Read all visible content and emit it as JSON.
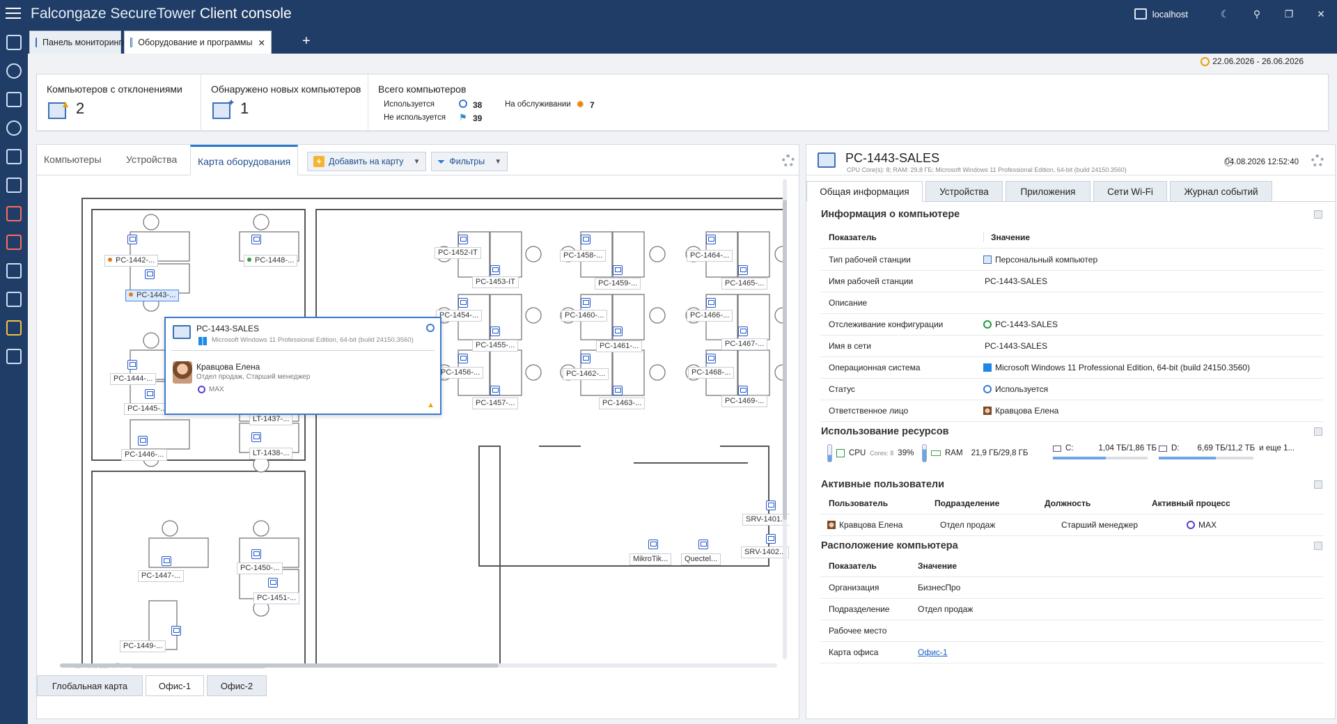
{
  "app": {
    "title_prefix": "Falcongaze SecureTower",
    "title_suffix": "Client console",
    "server": "localhost"
  },
  "doc_tabs": [
    {
      "label": "Панель мониторинга",
      "pinned": true
    },
    {
      "label": "Оборудование и программы",
      "active": true
    }
  ],
  "stats": {
    "deviations_label": "Компьютеров с отклонениями",
    "deviations_value": "2",
    "new_label": "Обнаружено новых компьютеров",
    "new_value": "1",
    "total_label": "Всего компьютеров",
    "used_label": "Используется",
    "used_value": "38",
    "unused_label": "Не используется",
    "unused_value": "39",
    "service_label": "На обслуживании",
    "service_value": "7"
  },
  "date_range": "22.06.2026 - 26.06.2026",
  "left": {
    "tabs": [
      "Компьютеры",
      "Устройства",
      "Карта оборудования"
    ],
    "add_button": "Добавить на карту",
    "filter_button": "Фильтры",
    "zoom": "100%",
    "bottom_tabs": [
      "Глобальная карта",
      "Офис-1",
      "Офис-2"
    ]
  },
  "map": {
    "labels": [
      {
        "id": "l1442",
        "text": "PC-1442-...",
        "dot": "#e07a1f"
      },
      {
        "id": "l1448",
        "text": "PC-1448-...",
        "dot": "#2e9e3a"
      },
      {
        "id": "l1443",
        "text": "PC-1443-...",
        "dot": "#e07a1f",
        "selected": true
      },
      {
        "id": "l1444",
        "text": "PC-1444-..."
      },
      {
        "id": "l1445",
        "text": "PC-1445-..."
      },
      {
        "id": "l1437",
        "text": "LT-1437-..."
      },
      {
        "id": "l1446",
        "text": "PC-1446-..."
      },
      {
        "id": "l1438",
        "text": "LT-1438-..."
      },
      {
        "id": "l1447",
        "text": "PC-1447-..."
      },
      {
        "id": "l1450",
        "text": "PC-1450-..."
      },
      {
        "id": "l1451",
        "text": "PC-1451-..."
      },
      {
        "id": "l1449",
        "text": "PC-1449-..."
      },
      {
        "id": "l1452",
        "text": "PC-1452-IT"
      },
      {
        "id": "l1453",
        "text": "PC-1453-IT"
      },
      {
        "id": "l1454",
        "text": "PC-1454-..."
      },
      {
        "id": "l1455",
        "text": "PC-1455-..."
      },
      {
        "id": "l1456",
        "text": "PC-1456-..."
      },
      {
        "id": "l1457",
        "text": "PC-1457-..."
      },
      {
        "id": "l1458",
        "text": "PC-1458-..."
      },
      {
        "id": "l1459",
        "text": "PC-1459-..."
      },
      {
        "id": "l1460",
        "text": "PC-1460-..."
      },
      {
        "id": "l1461",
        "text": "PC-1461-..."
      },
      {
        "id": "l1462",
        "text": "PC-1462-..."
      },
      {
        "id": "l1463",
        "text": "PC-1463-..."
      },
      {
        "id": "l1464",
        "text": "PC-1464-..."
      },
      {
        "id": "l1465",
        "text": "PC-1465-..."
      },
      {
        "id": "l1466",
        "text": "PC-1466-..."
      },
      {
        "id": "l1467",
        "text": "PC-1467-..."
      },
      {
        "id": "l1468",
        "text": "PC-1468-..."
      },
      {
        "id": "l1469",
        "text": "PC-1469-..."
      },
      {
        "id": "lsrv1401",
        "text": "SRV-1401..."
      },
      {
        "id": "lsrv1402",
        "text": "SRV-1402..."
      },
      {
        "id": "lmikro",
        "text": "MikroTik..."
      },
      {
        "id": "lquec",
        "text": "Quectel..."
      }
    ],
    "popup": {
      "name": "PC-1443-SALES",
      "os": "Microsoft Windows 11 Professional Edition, 64-bit (build 24150.3560)",
      "user": "Кравцова Елена",
      "dept": "Отдел продаж, Старший менеджер",
      "app": "MAX"
    }
  },
  "right": {
    "name": "PC-1443-SALES",
    "spec": "CPU Core(s): 8; RAM: 29,8 ГБ; Microsoft Windows 11 Professional Edition, 64-bit (build 24150.3560)",
    "datetime": "04.08.2026 12:52:40",
    "tabs": [
      "Общая информация",
      "Устройства",
      "Приложения",
      "Сети Wi-Fi",
      "Журнал событий"
    ],
    "info_title": "Информация о компьютере",
    "info_head": {
      "k": "Показатель",
      "v": "Значение"
    },
    "info": [
      {
        "k": "Тип рабочей станции",
        "v": "Персональный компьютер"
      },
      {
        "k": "Имя рабочей станции",
        "v": "PC-1443-SALES"
      },
      {
        "k": "Описание",
        "v": ""
      },
      {
        "k": "Отслеживание конфигурации",
        "v": "PC-1443-SALES"
      },
      {
        "k": "Имя в сети",
        "v": "PC-1443-SALES"
      },
      {
        "k": "Операционная система",
        "v": "Microsoft Windows 11 Professional Edition, 64-bit (build 24150.3560)"
      },
      {
        "k": "Статус",
        "v": "Используется"
      },
      {
        "k": "Ответственное лицо",
        "v": "Кравцова Елена"
      }
    ],
    "res_title": "Использование ресурсов",
    "res": {
      "cpu": "CPU",
      "cores": "Cores: 8",
      "cpu_pct": "39%",
      "ram": "RAM",
      "ram_val": "21,9 ГБ/29,8 ГБ",
      "c": "C:",
      "c_val": "1,04 ТБ/1,86 ТБ",
      "d": "D:",
      "d_val": "6,69 ТБ/11,2 ТБ",
      "more": "и еще 1...",
      "c_frac": 0.56,
      "d_frac": 0.6
    },
    "users_title": "Активные пользователи",
    "users_head": [
      "Пользователь",
      "Подразделение",
      "Должность",
      "Активный процесс"
    ],
    "user_row": [
      "Кравцова Елена",
      "Отдел продаж",
      "Старший менеджер",
      "MAX"
    ],
    "loc_title": "Расположение компьютера",
    "loc_head": {
      "k": "Показатель",
      "v": "Значение"
    },
    "loc": [
      {
        "k": "Организация",
        "v": "БизнесПро"
      },
      {
        "k": "Подразделение",
        "v": "Отдел продаж"
      },
      {
        "k": "Рабочее место",
        "v": ""
      },
      {
        "k": "Карта офиса",
        "v": "Офис-1"
      }
    ]
  }
}
